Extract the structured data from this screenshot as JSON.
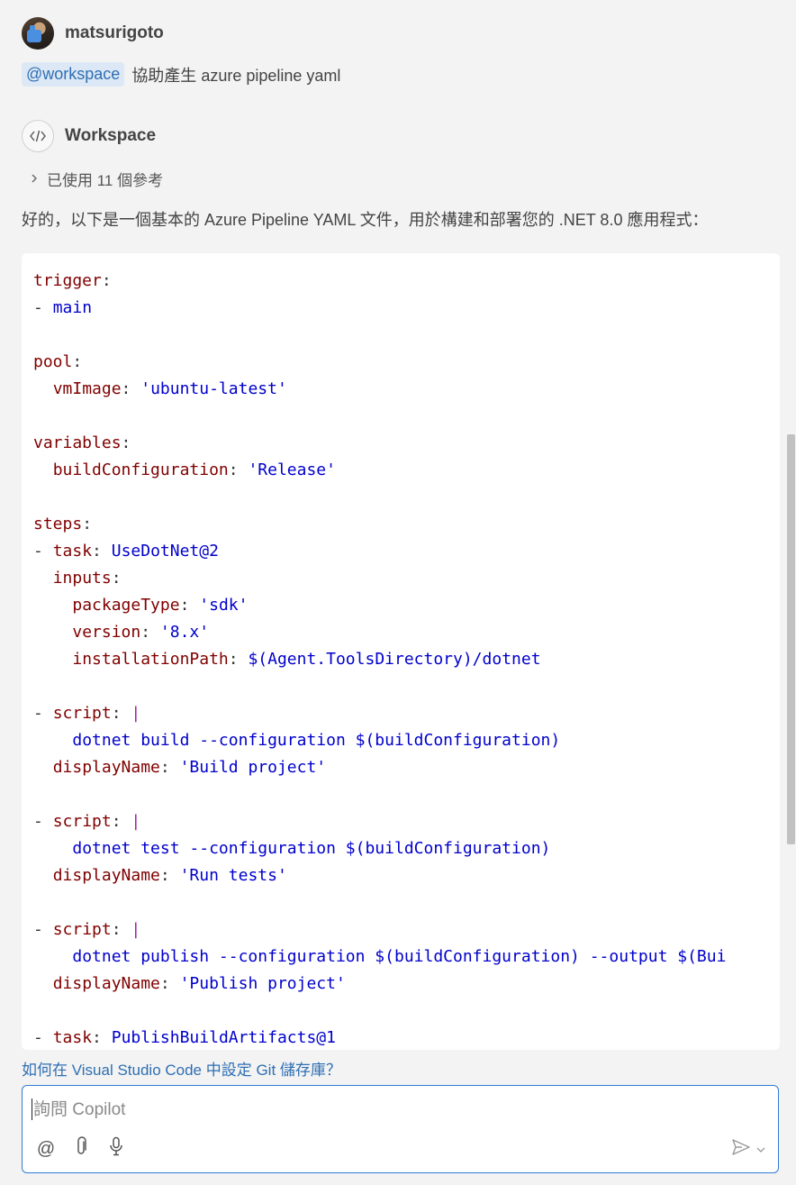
{
  "user": {
    "name": "matsurigoto"
  },
  "prompt": {
    "mention": "@workspace",
    "text": "協助產生 azure pipeline yaml"
  },
  "assistant": {
    "name": "Workspace",
    "references": "已使用 11 個參考",
    "answer": "好的，以下是一個基本的 Azure Pipeline YAML 文件，用於構建和部署您的 .NET 8.0 應用程式："
  },
  "code": {
    "l1_key": "trigger",
    "l2_val": "main",
    "l4_key": "pool",
    "l5_key": "vmImage",
    "l5_val": "'ubuntu-latest'",
    "l7_key": "variables",
    "l8_key": "buildConfiguration",
    "l8_val": "'Release'",
    "l10_key": "steps",
    "l11_key": "task",
    "l11_val": "UseDotNet@2",
    "l12_key": "inputs",
    "l13_key": "packageType",
    "l13_val": "'sdk'",
    "l14_key": "version",
    "l14_val": "'8.x'",
    "l15_key": "installationPath",
    "l15_val": "$(Agent.ToolsDirectory)/dotnet",
    "l17_key": "script",
    "l18_val": "dotnet build --configuration $(buildConfiguration)",
    "l19_key": "displayName",
    "l19_val": "'Build project'",
    "l21_key": "script",
    "l22_val": "dotnet test --configuration $(buildConfiguration)",
    "l23_key": "displayName",
    "l23_val": "'Run tests'",
    "l25_key": "script",
    "l26_val": "dotnet publish --configuration $(buildConfiguration) --output $(Bui",
    "l27_key": "displayName",
    "l27_val": "'Publish project'",
    "l29_key": "task",
    "l29_val": "PublishBuildArtifacts@1"
  },
  "suggestion": "如何在 Visual Studio Code 中設定 Git 儲存庫？",
  "input": {
    "placeholder": "詢問 Copilot",
    "value": ""
  },
  "toolbar": {
    "mention_label": "@"
  },
  "icons": [
    "attach-icon",
    "mic-icon",
    "send-icon",
    "chevron-down-icon",
    "code-icon",
    "chevron-right-icon"
  ],
  "colors": {
    "accent": "#2f7cd6",
    "yaml_key": "#800000",
    "yaml_value": "#0000cc",
    "block_bar": "#a31ea3"
  }
}
